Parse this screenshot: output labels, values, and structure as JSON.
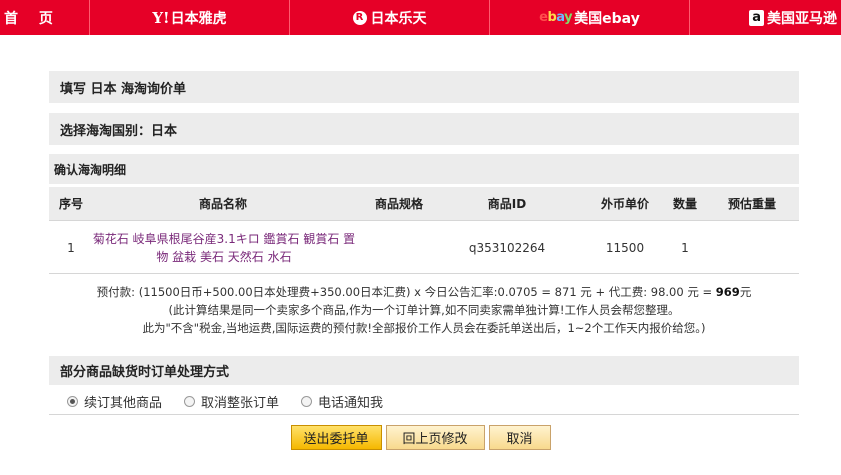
{
  "nav": {
    "home": "首 页",
    "yahoo": {
      "logo": "Y!",
      "label": "日本雅虎"
    },
    "rakuten": {
      "logo": "R",
      "label": "日本乐天"
    },
    "ebay": {
      "logo": "ebay",
      "label": "美国ebay"
    },
    "amazon": {
      "logo": "a",
      "label": "美国亚马逊"
    },
    "brand_color": "#e60027"
  },
  "form": {
    "title": "填写 日本 海淘询价单",
    "country": "选择海淘国别：日本",
    "detail_title": "确认海淘明细",
    "columns": [
      "序号",
      "商品名称",
      "商品规格",
      "商品ID",
      "外币单价",
      "数量",
      "预估重量"
    ],
    "items": [
      {
        "seq": "1",
        "name_line1": "菊花石 岐阜県根尾谷産3.1キロ 鑑賞石 観賞石 置",
        "name_line2": "物 盆栽 美石 天然石 水石",
        "spec": "",
        "id": "q353102264",
        "price": "11500",
        "qty": "1",
        "weight": ""
      }
    ],
    "calc": {
      "line1_pre": "预付款: (11500日币+500.00日本处理费+350.00日本汇费) x 今日公告汇率:0.0705 = 871 元 + 代工费: 98.00 元 = ",
      "total": "969",
      "line1_post": "元",
      "line2": "(此计算结果是同一个卖家多个商品,作为一个订单计算,如不同卖家需单独计算!工作人员会帮您整理。",
      "line3": "此为\"不含\"税金,当地运费,国际运费的预付款!全部报价工作人员会在委託单送出后，1~2个工作天内报价给您。)"
    },
    "method_title": "部分商品缺货时订单处理方式",
    "options": [
      {
        "label": "续订其他商品",
        "checked": true
      },
      {
        "label": "取消整张订单",
        "checked": false
      },
      {
        "label": "电话通知我",
        "checked": false
      }
    ],
    "buttons": {
      "submit": "送出委托单",
      "back": "回上页修改",
      "cancel": "取消"
    }
  }
}
